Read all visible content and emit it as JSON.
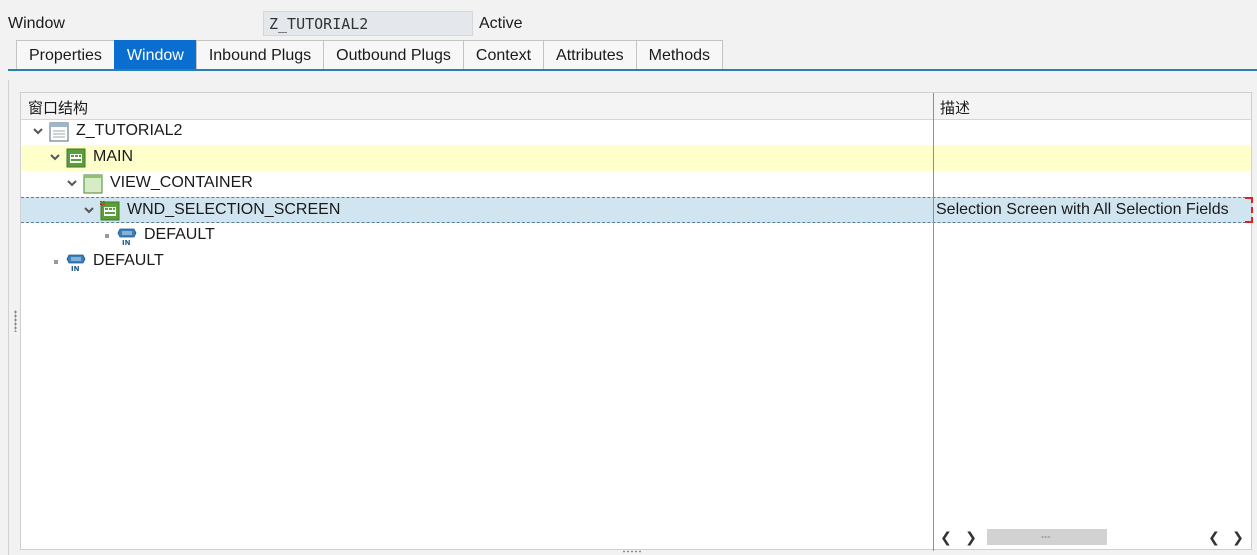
{
  "header": {
    "label": "Window",
    "window_name": "Z_TUTORIAL2",
    "status": "Active"
  },
  "tabs": [
    {
      "label": "Properties",
      "active": false
    },
    {
      "label": "Window",
      "active": true
    },
    {
      "label": "Inbound Plugs",
      "active": false
    },
    {
      "label": "Outbound Plugs",
      "active": false
    },
    {
      "label": "Context",
      "active": false
    },
    {
      "label": "Attributes",
      "active": false
    },
    {
      "label": "Methods",
      "active": false
    }
  ],
  "tree": {
    "columns": {
      "structure": "窗口结构",
      "description": "描述"
    },
    "nodes": [
      {
        "label": "Z_TUTORIAL2",
        "icon": "window-icon",
        "description": ""
      },
      {
        "label": "MAIN",
        "icon": "view-icon",
        "description": ""
      },
      {
        "label": "VIEW_CONTAINER",
        "icon": "view-container-icon",
        "description": ""
      },
      {
        "label": "WND_SELECTION_SCREEN",
        "icon": "view-icon",
        "description": "Selection Screen with All Selection Fields"
      },
      {
        "label": "DEFAULT",
        "icon": "inbound-plug-icon",
        "description": ""
      },
      {
        "label": "DEFAULT",
        "icon": "inbound-plug-icon",
        "description": ""
      }
    ]
  },
  "colors": {
    "active_tab": "#0a6ed1",
    "highlight_row": "#ffffcc",
    "selected_row": "#d1e5f0",
    "view_icon_green": "#5a9e3a",
    "plug_icon_blue": "#3a7fb8"
  }
}
